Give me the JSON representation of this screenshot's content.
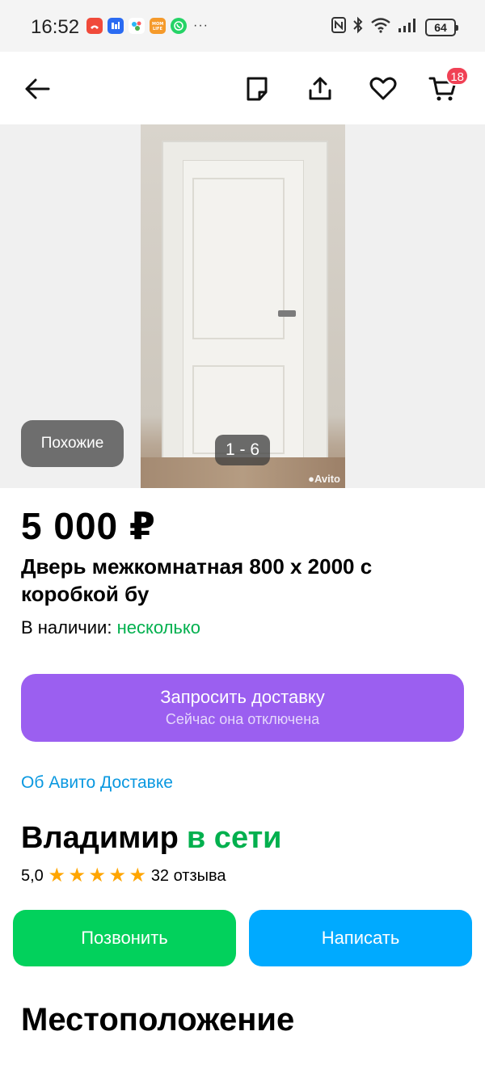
{
  "status_bar": {
    "time": "16:52",
    "battery": "64",
    "notification_icons": [
      {
        "name": "missed-call-icon",
        "color": "#f04a3a"
      },
      {
        "name": "app-blue-icon",
        "color": "#2a6bf2"
      },
      {
        "name": "app-dots-icon",
        "color": "#ffffff"
      },
      {
        "name": "mom-life-icon",
        "color": "#f59a2a"
      },
      {
        "name": "whatsapp-icon",
        "color": "#25d366"
      }
    ],
    "more": "···"
  },
  "nav": {
    "cart_count": "18"
  },
  "gallery": {
    "similar_label": "Похожие",
    "counter": "1 - 6",
    "watermark": "Avito"
  },
  "listing": {
    "price": "5 000 ₽",
    "title": "Дверь межкомнатная 800 х 2000 с коробкой бу",
    "availability_label": "В наличии:",
    "availability_value": "несколько"
  },
  "delivery": {
    "button_label": "Запросить доставку",
    "button_sub": "Сейчас она отключена",
    "about_link": "Об Авито Доставке"
  },
  "seller": {
    "name": "Владимир",
    "status": "в сети",
    "rating": "5,0",
    "stars": 5,
    "reviews": "32 отзыва"
  },
  "actions": {
    "call_label": "Позвонить",
    "write_label": "Написать"
  },
  "location": {
    "title": "Местоположение"
  },
  "colors": {
    "accent_purple": "#9b5ff0",
    "green": "#02d15c",
    "blue": "#00aaff",
    "online_green": "#02b04e",
    "link_blue": "#0a98e0",
    "badge_red": "#f04155",
    "star": "#ffa500"
  }
}
